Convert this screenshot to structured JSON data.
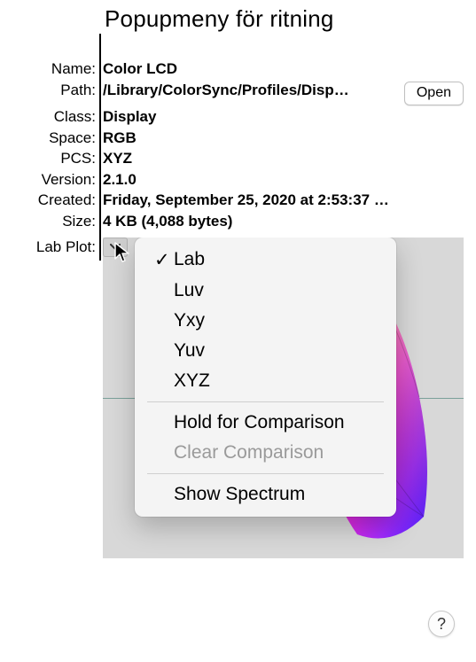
{
  "callout": {
    "label": "Popupmeny för ritning"
  },
  "info": {
    "labels": {
      "name": "Name:",
      "path": "Path:",
      "class": "Class:",
      "space": "Space:",
      "pcs": "PCS:",
      "version": "Version:",
      "created": "Created:",
      "size": "Size:",
      "labPlot": "Lab Plot:"
    },
    "values": {
      "name": "Color LCD",
      "path": "/Library/ColorSync/Profiles/Disp…",
      "class": "Display",
      "space": "RGB",
      "pcs": "XYZ",
      "version": "2.1.0",
      "created": "Friday, September 25, 2020 at 2:53:37 P…",
      "size": "4 KB (4,088 bytes)"
    },
    "openButton": "Open"
  },
  "menu": {
    "selected": "Lab",
    "items0": "Lab",
    "items1": "Luv",
    "items2": "Yxy",
    "items3": "Yuv",
    "items4": "XYZ",
    "items5": "Hold for Comparison",
    "items6": "Clear Comparison",
    "items7": "Show Spectrum"
  },
  "help": {
    "label": "?"
  }
}
